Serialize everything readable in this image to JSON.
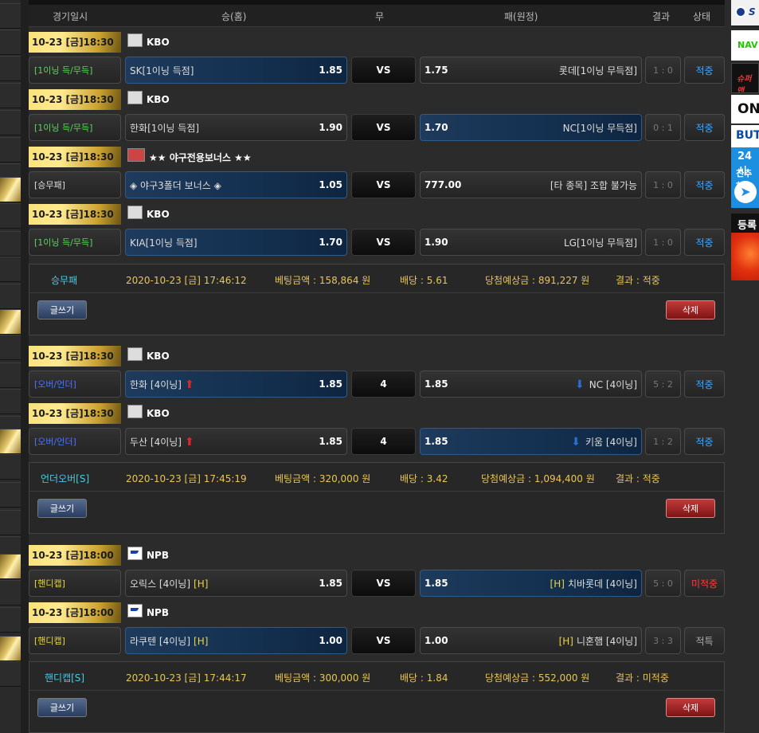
{
  "header": {
    "date": "경기일시",
    "home": "승(홈)",
    "draw": "무",
    "away": "패(원정)",
    "result": "결과",
    "status": "상태"
  },
  "bets": [
    {
      "games": [
        {
          "date": "10-23 [금]18:30",
          "league": "KBO",
          "league_icon": "kbo-logo-icon",
          "type": "[1이닝 득/무득]",
          "type_color": "green",
          "home": "SK[1이닝 득점]",
          "home_odds": "1.85",
          "mid": "VS",
          "away_odds": "1.75",
          "away": "롯데[1이닝 무득점]",
          "score": "1 : 0",
          "status": "적중",
          "status_kind": "hit",
          "selected": "home"
        },
        {
          "date": "10-23 [금]18:30",
          "league": "KBO",
          "league_icon": "kbo-logo-icon",
          "type": "[1이닝 득/무득]",
          "type_color": "green",
          "home": "한화[1이닝 득점]",
          "home_odds": "1.90",
          "mid": "VS",
          "away_odds": "1.70",
          "away": "NC[1이닝 무득점]",
          "score": "0 : 1",
          "status": "적중",
          "status_kind": "hit",
          "selected": "away"
        },
        {
          "date": "10-23 [금]18:30",
          "league": "★★ 야구전용보너스 ★★",
          "league_icon": "bonus-logo-icon",
          "type": "[승무패]",
          "type_color": "white",
          "home": "◈ 야구3폴더 보너스 ◈",
          "home_odds": "1.05",
          "mid": "VS",
          "away_odds": "777.00",
          "away": "[타 종목] 조합 불가능",
          "score": "1 : 0",
          "status": "적중",
          "status_kind": "hit",
          "selected": "home"
        },
        {
          "date": "10-23 [금]18:30",
          "league": "KBO",
          "league_icon": "kbo-logo-icon",
          "type": "[1이닝 득/무득]",
          "type_color": "green",
          "home": "KIA[1이닝 득점]",
          "home_odds": "1.70",
          "mid": "VS",
          "away_odds": "1.90",
          "away": "LG[1이닝 무득점]",
          "score": "1 : 0",
          "status": "적중",
          "status_kind": "hit",
          "selected": "home"
        }
      ],
      "summary": {
        "kind": "승무패",
        "time": "2020-10-23 [금] 17:46:12",
        "amount": "베팅금액 : 158,864 원",
        "rate": "배당 : 5.61",
        "expected": "당첨예상금 : 891,227 원",
        "result": "결과 : 적중",
        "write": "글쓰기",
        "delete": "삭제"
      }
    },
    {
      "games": [
        {
          "date": "10-23 [금]18:30",
          "league": "KBO",
          "league_icon": "kbo-logo-icon",
          "type": "[오버/언더]",
          "type_color": "blue",
          "home": "한화 [4이닝]",
          "home_odds": "1.85",
          "mid": "4",
          "away_odds": "1.85",
          "away": "NC [4이닝]",
          "score": "5 : 2",
          "status": "적중",
          "status_kind": "hit",
          "selected": "home",
          "arrows": true
        },
        {
          "date": "10-23 [금]18:30",
          "league": "KBO",
          "league_icon": "kbo-logo-icon",
          "type": "[오버/언더]",
          "type_color": "blue",
          "home": "두산 [4이닝]",
          "home_odds": "1.85",
          "mid": "4",
          "away_odds": "1.85",
          "away": "키움 [4이닝]",
          "score": "1 : 2",
          "status": "적중",
          "status_kind": "hit",
          "selected": "away",
          "arrows": true
        }
      ],
      "summary": {
        "kind": "언더오버[S]",
        "time": "2020-10-23 [금] 17:45:19",
        "amount": "베팅금액 : 320,000 원",
        "rate": "배당 : 3.42",
        "expected": "당첨예상금 : 1,094,400 원",
        "result": "결과 : 적중",
        "write": "글쓰기",
        "delete": "삭제"
      }
    },
    {
      "games": [
        {
          "date": "10-23 [금]18:00",
          "league": "NPB",
          "league_icon": "npb-logo-icon",
          "type": "[핸디캡]",
          "type_color": "yellow",
          "home": "오릭스 [4이닝]",
          "home_tag": "[H]",
          "home_odds": "1.85",
          "mid": "VS",
          "away_odds": "1.85",
          "away_tag": "[H]",
          "away": "치바롯데 [4이닝]",
          "score": "5 : 0",
          "status": "미적중",
          "status_kind": "miss",
          "selected": "away"
        },
        {
          "date": "10-23 [금]18:00",
          "league": "NPB",
          "league_icon": "npb-logo-icon",
          "type": "[핸디캡]",
          "type_color": "yellow",
          "home": "라쿠텐 [4이닝]",
          "home_tag": "[H]",
          "home_odds": "1.00",
          "mid": "VS",
          "away_odds": "1.00",
          "away_tag": "[H]",
          "away": "니혼햄 [4이닝]",
          "score": "3 : 3",
          "status": "적특",
          "status_kind": "special",
          "selected": "home"
        }
      ],
      "summary": {
        "kind": "핸디캡[S]",
        "time": "2020-10-23 [금] 17:44:17",
        "amount": "베팅금액 : 300,000 원",
        "rate": "배당 : 1.84",
        "expected": "당첨예상금 : 552,000 원",
        "result": "결과 : 미적중",
        "write": "글쓰기",
        "delete": "삭제"
      }
    }
  ],
  "right_banners": [
    "S",
    "NAV",
    "슈퍼맨",
    "ON",
    "BUT",
    "24시",
    "친추하",
    "등록"
  ]
}
